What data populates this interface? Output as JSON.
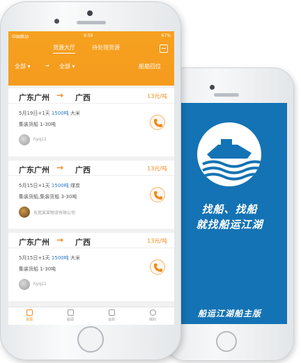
{
  "back_phone": {
    "slogan_line1": "找船、找船",
    "slogan_line2": "就找船运江湖",
    "brand": "船运江湖船主版",
    "brand_color": "#1473b4"
  },
  "front_phone": {
    "status": {
      "carrier": "中国移动",
      "time": "9:59",
      "battery": "67%"
    },
    "tabs": [
      "货源大厅",
      "待处理货源"
    ],
    "filters": {
      "from": "全部",
      "to": "全部",
      "post": "船舶回位"
    },
    "cards": [
      {
        "from": "广东广州",
        "to": "广西",
        "price": "13元/吨",
        "line1_pre": "5月19日+1天",
        "tons": "1500吨",
        "line1_post": "大米",
        "line2": "集装货船 1-30吨",
        "user": "hyq11",
        "avatar": "grey"
      },
      {
        "from": "广东广州",
        "to": "广西",
        "price": "13元/吨",
        "line1_pre": "5月15日+1天",
        "tons": "1500吨",
        "line1_post": "煤炭",
        "line2": "集装货船,集装货船 3-30吨",
        "user": "东莞某某物流有限公司",
        "avatar": "dark"
      },
      {
        "from": "广东广州",
        "to": "广西",
        "price": "13元/吨",
        "line1_pre": "5月15日+1天",
        "tons": "1500吨",
        "line1_post": "大米",
        "line2": "集装货船 1-30吨",
        "user": "hyq11",
        "avatar": "grey"
      }
    ],
    "tabbar": [
      "货源",
      "船源",
      "运单",
      "我的"
    ],
    "accent_color": "#f59b1e"
  }
}
